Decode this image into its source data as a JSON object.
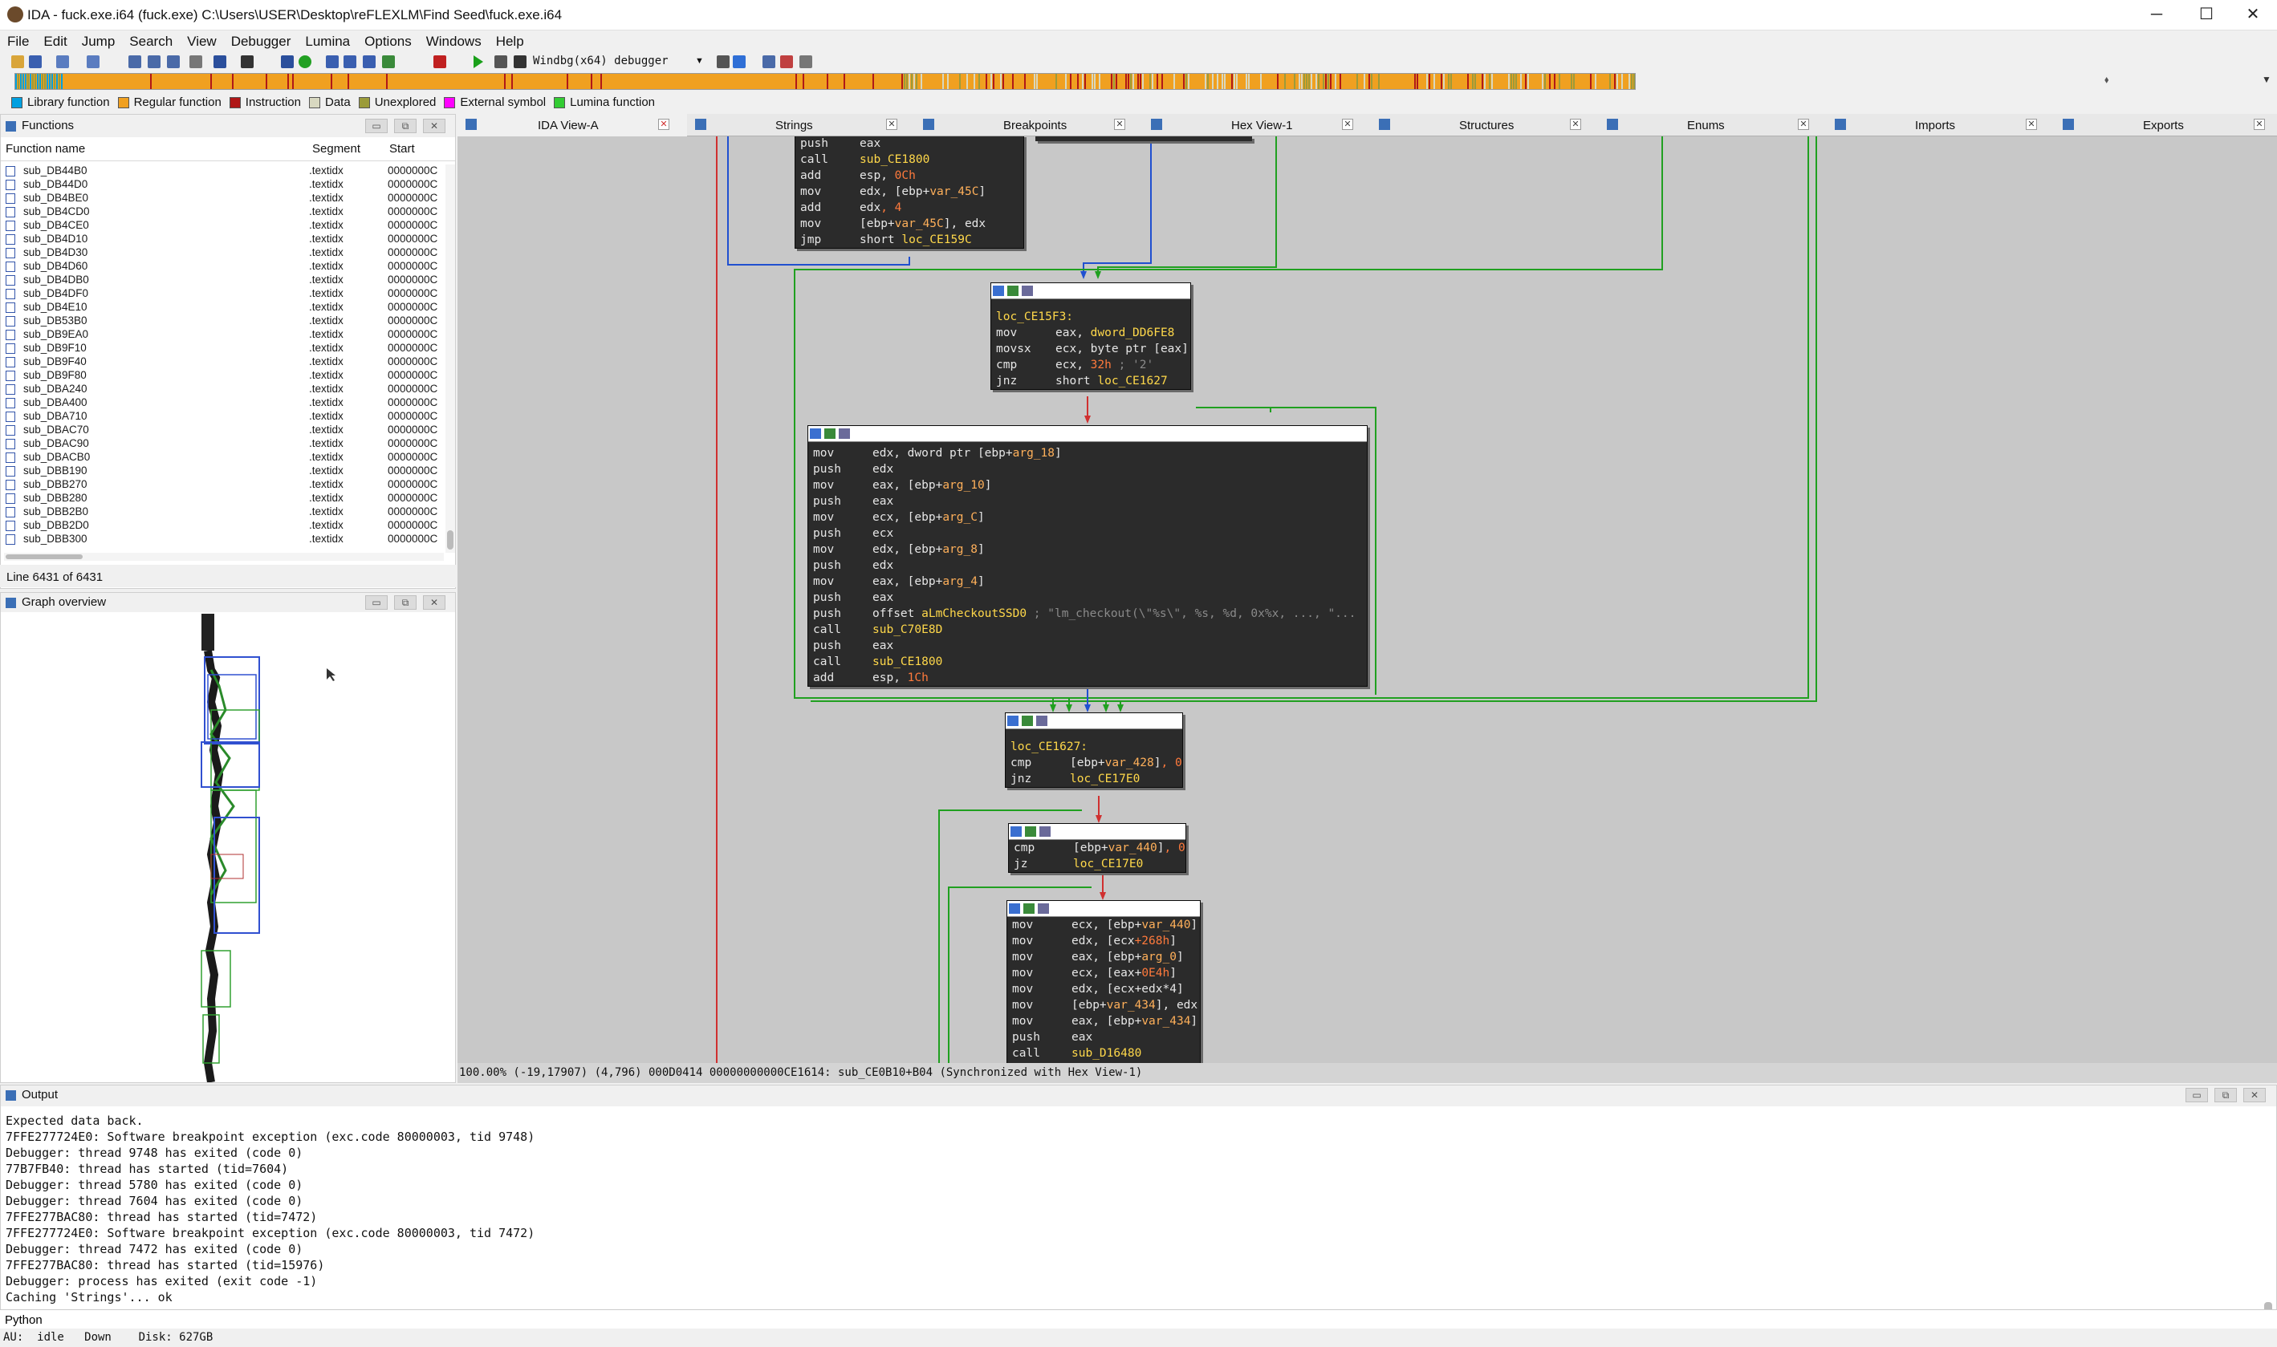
{
  "window": {
    "title": "IDA - fuck.exe.i64 (fuck.exe) C:\\Users\\USER\\Desktop\\reFLEXLM\\Find Seed\\fuck.exe.i64",
    "min_label": "─",
    "max_label": "☐",
    "close_label": "✕"
  },
  "menu": [
    "File",
    "Edit",
    "Jump",
    "Search",
    "View",
    "Debugger",
    "Lumina",
    "Options",
    "Windows",
    "Help"
  ],
  "toolbar": {
    "debugger_select": "Windbg(x64) debugger"
  },
  "legend": [
    {
      "label": "Library function",
      "color": "#00a0e0"
    },
    {
      "label": "Regular function",
      "color": "#f0a020"
    },
    {
      "label": "Instruction",
      "color": "#b01818"
    },
    {
      "label": "Data",
      "color": "#d8d8c0"
    },
    {
      "label": "Unexplored",
      "color": "#9b9b3a"
    },
    {
      "label": "External symbol",
      "color": "#ff00ff"
    },
    {
      "label": "Lumina function",
      "color": "#33cc33"
    }
  ],
  "functions": {
    "title": "Functions",
    "col_name": "Function name",
    "col_segment": "Segment",
    "col_start": "Start",
    "rows": [
      {
        "name": "sub_DB44B0",
        "seg": ".textidx",
        "start": "0000000C"
      },
      {
        "name": "sub_DB44D0",
        "seg": ".textidx",
        "start": "0000000C"
      },
      {
        "name": "sub_DB4BE0",
        "seg": ".textidx",
        "start": "0000000C"
      },
      {
        "name": "sub_DB4CD0",
        "seg": ".textidx",
        "start": "0000000C"
      },
      {
        "name": "sub_DB4CE0",
        "seg": ".textidx",
        "start": "0000000C"
      },
      {
        "name": "sub_DB4D10",
        "seg": ".textidx",
        "start": "0000000C"
      },
      {
        "name": "sub_DB4D30",
        "seg": ".textidx",
        "start": "0000000C"
      },
      {
        "name": "sub_DB4D60",
        "seg": ".textidx",
        "start": "0000000C"
      },
      {
        "name": "sub_DB4DB0",
        "seg": ".textidx",
        "start": "0000000C"
      },
      {
        "name": "sub_DB4DF0",
        "seg": ".textidx",
        "start": "0000000C"
      },
      {
        "name": "sub_DB4E10",
        "seg": ".textidx",
        "start": "0000000C"
      },
      {
        "name": "sub_DB53B0",
        "seg": ".textidx",
        "start": "0000000C"
      },
      {
        "name": "sub_DB9EA0",
        "seg": ".textidx",
        "start": "0000000C"
      },
      {
        "name": "sub_DB9F10",
        "seg": ".textidx",
        "start": "0000000C"
      },
      {
        "name": "sub_DB9F40",
        "seg": ".textidx",
        "start": "0000000C"
      },
      {
        "name": "sub_DB9F80",
        "seg": ".textidx",
        "start": "0000000C"
      },
      {
        "name": "sub_DBA240",
        "seg": ".textidx",
        "start": "0000000C"
      },
      {
        "name": "sub_DBA400",
        "seg": ".textidx",
        "start": "0000000C"
      },
      {
        "name": "sub_DBA710",
        "seg": ".textidx",
        "start": "0000000C"
      },
      {
        "name": "sub_DBAC70",
        "seg": ".textidx",
        "start": "0000000C"
      },
      {
        "name": "sub_DBAC90",
        "seg": ".textidx",
        "start": "0000000C"
      },
      {
        "name": "sub_DBACB0",
        "seg": ".textidx",
        "start": "0000000C"
      },
      {
        "name": "sub_DBB190",
        "seg": ".textidx",
        "start": "0000000C"
      },
      {
        "name": "sub_DBB270",
        "seg": ".textidx",
        "start": "0000000C"
      },
      {
        "name": "sub_DBB280",
        "seg": ".textidx",
        "start": "0000000C"
      },
      {
        "name": "sub_DBB2B0",
        "seg": ".textidx",
        "start": "0000000C"
      },
      {
        "name": "sub_DBB2D0",
        "seg": ".textidx",
        "start": "0000000C"
      },
      {
        "name": "sub_DBB300",
        "seg": ".textidx",
        "start": "0000000C"
      }
    ],
    "line_info": "Line 6431 of 6431"
  },
  "graph_overview": {
    "title": "Graph overview"
  },
  "tabs": [
    {
      "label": "IDA View-A"
    },
    {
      "label": "Strings"
    },
    {
      "label": "Breakpoints"
    },
    {
      "label": "Hex View-1"
    },
    {
      "label": "Structures"
    },
    {
      "label": "Enums"
    },
    {
      "label": "Imports"
    },
    {
      "label": "Exports"
    }
  ],
  "blocks": {
    "b1": [
      [
        "push",
        "eax"
      ],
      [
        "call",
        "sub_CE1800"
      ],
      [
        "add",
        "esp, 0Ch"
      ],
      [
        "mov",
        "edx, [ebp+var_45C]"
      ],
      [
        "add",
        "edx, 4"
      ],
      [
        "mov",
        "[ebp+var_45C], edx"
      ],
      [
        "jmp",
        "short loc_CE159C"
      ]
    ],
    "b2_label": "loc_CE15F3:",
    "b2": [
      [
        "mov",
        "eax, dword_DD6FE8"
      ],
      [
        "movsx",
        "ecx, byte ptr [eax]"
      ],
      [
        "cmp",
        "ecx, 32h ; '2'"
      ],
      [
        "jnz",
        "short loc_CE1627"
      ]
    ],
    "b3": [
      [
        "mov",
        "edx, dword ptr [ebp+arg_18]"
      ],
      [
        "push",
        "edx"
      ],
      [
        "mov",
        "eax, [ebp+arg_10]"
      ],
      [
        "push",
        "eax"
      ],
      [
        "mov",
        "ecx, [ebp+arg_C]"
      ],
      [
        "push",
        "ecx"
      ],
      [
        "mov",
        "edx, [ebp+arg_8]"
      ],
      [
        "push",
        "edx"
      ],
      [
        "mov",
        "eax, [ebp+arg_4]"
      ],
      [
        "push",
        "eax"
      ],
      [
        "push",
        "offset aLmCheckoutSSD0 ; \"lm_checkout(\\\"%s\\\", %s, %d, 0x%x, ..., \"..."
      ],
      [
        "call",
        "sub_C70E8D"
      ],
      [
        "push",
        "eax"
      ],
      [
        "call",
        "sub_CE1800"
      ],
      [
        "add",
        "esp, 1Ch"
      ]
    ],
    "b4_label": "loc_CE1627:",
    "b4": [
      [
        "cmp",
        "[ebp+var_428], 0"
      ],
      [
        "jnz",
        "loc_CE17E0"
      ]
    ],
    "b5": [
      [
        "cmp",
        "[ebp+var_440], 0"
      ],
      [
        "jz",
        "loc_CE17E0"
      ]
    ],
    "b6": [
      [
        "mov",
        "ecx, [ebp+var_440]"
      ],
      [
        "mov",
        "edx, [ecx+268h]"
      ],
      [
        "mov",
        "eax, [ebp+arg_0]"
      ],
      [
        "mov",
        "ecx, [eax+0E4h]"
      ],
      [
        "mov",
        "edx, [ecx+edx*4]"
      ],
      [
        "mov",
        "[ebp+var_434], edx"
      ],
      [
        "mov",
        "eax, [ebp+var_434]"
      ],
      [
        "push",
        "eax"
      ],
      [
        "call",
        "sub_D16480"
      ]
    ]
  },
  "status_line": "100.00% (-19,17907) (4,796) 000D0414 00000000000CE1614: sub_CE0B10+B04 (Synchronized with Hex View-1)",
  "output": {
    "title": "Output",
    "lines": [
      "Expected data back.",
      "7FFE277724E0: Software breakpoint exception (exc.code 80000003, tid 9748)",
      "Debugger: thread 9748 has exited (code 0)",
      "77B7FB40: thread has started (tid=7604)",
      "Debugger: thread 5780 has exited (code 0)",
      "Debugger: thread 7604 has exited (code 0)",
      "7FFE277BAC80: thread has started (tid=7472)",
      "7FFE277724E0: Software breakpoint exception (exc.code 80000003, tid 7472)",
      "Debugger: thread 7472 has exited (code 0)",
      "7FFE277BAC80: thread has started (tid=15976)",
      "Debugger: process has exited (exit code -1)",
      "Caching 'Strings'... ok"
    ]
  },
  "python_label": "Python",
  "bottom_status": "AU:  idle   Down    Disk: 627GB"
}
